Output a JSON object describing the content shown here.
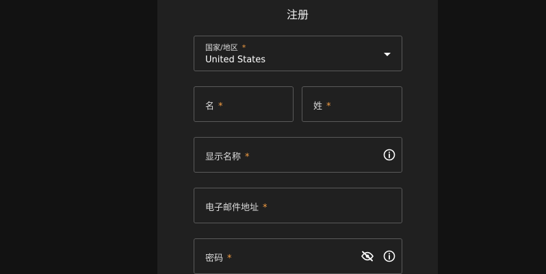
{
  "form": {
    "title": "注册",
    "country": {
      "label": "国家/地区",
      "required_mark": "*",
      "value": "United States"
    },
    "first_name": {
      "label": "名",
      "required_mark": "*"
    },
    "last_name": {
      "label": "姓",
      "required_mark": "*"
    },
    "display_name": {
      "label": "显示名称",
      "required_mark": "*",
      "icon": "info-icon"
    },
    "email": {
      "label": "电子邮件地址",
      "required_mark": "*"
    },
    "password": {
      "label": "密码",
      "required_mark": "*",
      "icons": [
        "eye-off-icon",
        "info-icon"
      ]
    }
  },
  "colors": {
    "background": "#121212",
    "panel": "#202020",
    "border": "#5a5a5a",
    "required": "#f59e42",
    "text": "#f2f2f2"
  }
}
